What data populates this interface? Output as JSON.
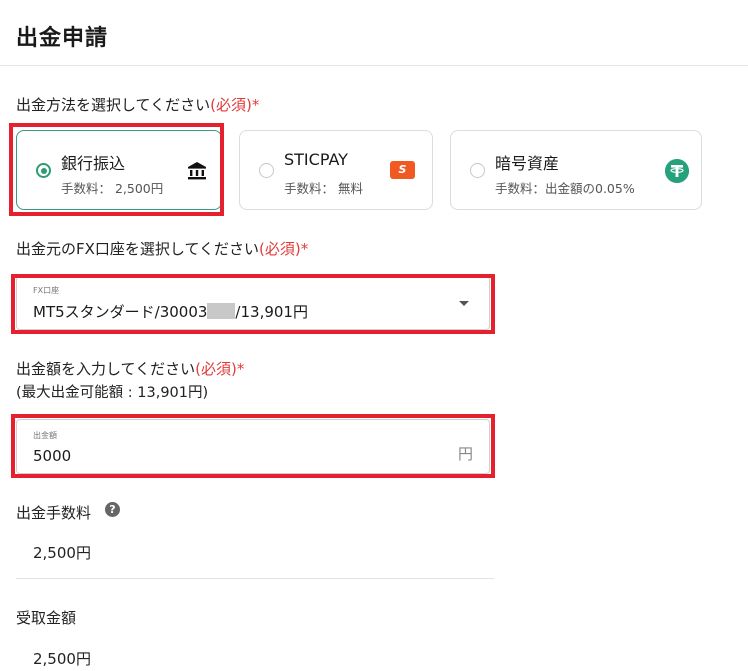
{
  "header": {
    "title": "出金申請"
  },
  "method_section": {
    "label": "出金方法を選択してください",
    "required": "(必須)*"
  },
  "methods": [
    {
      "name": "銀行振込",
      "fee": "手数料： 2,500円",
      "icon": "bank-icon",
      "selected": true
    },
    {
      "name": "STICPAY",
      "fee": "手数料： 無料",
      "icon": "sticpay-icon",
      "icon_text": "S",
      "selected": false
    },
    {
      "name": "暗号資産",
      "fee": "手数料：出金額の0.05%",
      "icon": "tether-icon",
      "selected": false
    }
  ],
  "account_section": {
    "label": "出金元のFX口座を選択してください",
    "required": "(必須)*"
  },
  "account_select": {
    "label": "FX口座",
    "value_prefix": "MT5スタンダード/30003",
    "value_suffix": "/13,901円"
  },
  "amount_section": {
    "label": "出金額を入力してください",
    "required": "(必須)*",
    "max_note": "(最大出金可能額 : 13,901円)"
  },
  "amount_input": {
    "label": "出金額",
    "value": "5000",
    "unit": "円"
  },
  "fee_section": {
    "label": "出金手数料",
    "help_icon": "?",
    "value": "2,500円"
  },
  "receive_section": {
    "label": "受取金額",
    "value": "2,500円"
  },
  "colors": {
    "accent": "#2e9b73",
    "required": "#e03c3c",
    "highlight": "#e5212f",
    "sticpay": "#f05a22",
    "tether": "#26a17b"
  }
}
